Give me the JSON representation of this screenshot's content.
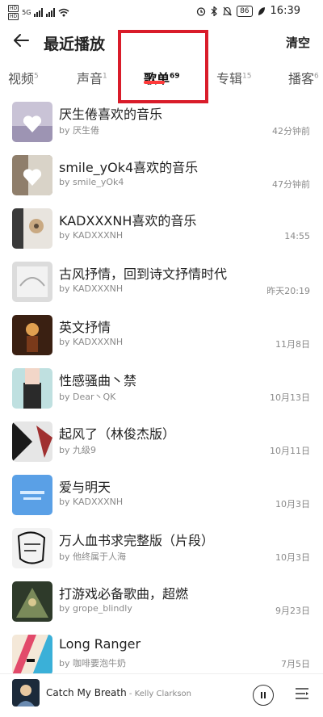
{
  "status": {
    "sim1": "HD",
    "sim2": "HD",
    "net": "5G",
    "battery": "86",
    "time": "16:39"
  },
  "header": {
    "title": "最近播放",
    "clear_label": "清空",
    "back_icon": "back-arrow-icon"
  },
  "tabs": [
    {
      "label": "视频",
      "count": "5"
    },
    {
      "label": "声音",
      "count": "1"
    },
    {
      "label": "歌单",
      "count": "69",
      "active": true
    },
    {
      "label": "专辑",
      "count": "15"
    },
    {
      "label": "播客",
      "count": "6"
    }
  ],
  "playlists": [
    {
      "title": "厌生倦喜欢的音乐",
      "author": "by 厌生倦",
      "time": "42分钟前"
    },
    {
      "title": "smile_yOk4喜欢的音乐",
      "author": "by smile_yOk4",
      "time": "47分钟前"
    },
    {
      "title": "KADXXXNH喜欢的音乐",
      "author": "by KADXXXNH",
      "time": "14:55"
    },
    {
      "title": "古风抒情，回到诗文抒情时代",
      "author": "by KADXXXNH",
      "time": "昨天20:19"
    },
    {
      "title": "英文抒情",
      "author": "by KADXXXNH",
      "time": "11月8日"
    },
    {
      "title": "性感骚曲丶禁",
      "author": "by Dear丶QK",
      "time": "10月13日"
    },
    {
      "title": "起风了（林俊杰版）",
      "author": "by 九级9",
      "time": "10月11日"
    },
    {
      "title": "爱与明天",
      "author": "by KADXXXNH",
      "time": "10月3日"
    },
    {
      "title": "万人血书求完整版（片段）",
      "author": "by 他终属于人海",
      "time": "10月3日"
    },
    {
      "title": "打游戏必备歌曲，超燃",
      "author": "by grope_blindly",
      "time": "9月23日"
    },
    {
      "title": "Long Ranger",
      "author": "by 咖啡要泡牛奶",
      "time": "7月5日"
    }
  ],
  "player": {
    "song": "Catch My Breath",
    "separator": " - ",
    "artist": "Kelly Clarkson"
  },
  "colors": {
    "accent": "#ff3a3a",
    "highlight_box": "#d91c2a"
  }
}
